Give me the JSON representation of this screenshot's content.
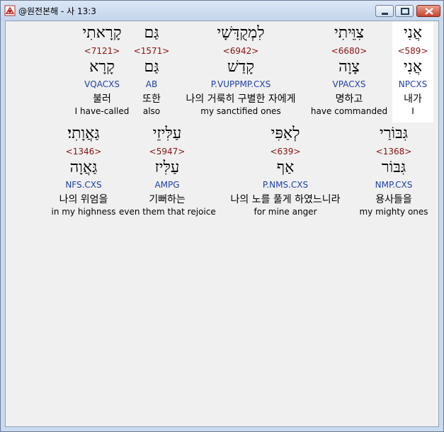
{
  "window": {
    "title": "@원전본해 - 사 13:3"
  },
  "row1": [
    {
      "word": "אֲנִי",
      "strong": "<589>",
      "lemma": "אֲנִי",
      "morph": "NPCXS",
      "korean": "내가",
      "english": "I",
      "highlight": true
    },
    {
      "word": "צִוֵּיתִי",
      "strong": "<6680>",
      "lemma": "צָוָה",
      "morph": "VPACXS",
      "korean": "명하고",
      "english": "have commanded",
      "highlight": false
    },
    {
      "word": "לִמְקֻדָּשָׁי",
      "strong": "<6942>",
      "lemma": "קָדַשׁ",
      "morph": "P.VUPPMP.CXS",
      "korean": "나의 거룩히 구별한 자에게",
      "english": "my sanctified ones",
      "highlight": false
    },
    {
      "word": "גַּם",
      "strong": "<1571>",
      "lemma": "גַּם",
      "morph": "AB",
      "korean": "또한",
      "english": "also",
      "highlight": false
    },
    {
      "word": "קָרָאתִי",
      "strong": "<7121>",
      "lemma": "קָרָא",
      "morph": "VQACXS",
      "korean": "불러",
      "english": "I have-called",
      "highlight": false
    }
  ],
  "row2": [
    {
      "word": "גִּבּוֹרַי",
      "strong": "<1368>",
      "lemma": "גִּבּוֹר",
      "morph": "NMP.CXS",
      "korean": "용사들을",
      "english": "my mighty ones"
    },
    {
      "word": "לְאַפִּי",
      "strong": "<639>",
      "lemma": "אַף",
      "morph": "P.NMS.CXS",
      "korean": "나의 노를 풀게 하였느니라",
      "english": "for mine anger"
    },
    {
      "word": "עַלִּיזֵי",
      "strong": "<5947>",
      "lemma": "עַלִּיז",
      "morph": "AMPG",
      "korean": "기뻐하는",
      "english": "even them that rejoice"
    },
    {
      "word": "גַּאֲוָתִי׃",
      "strong": "<1346>",
      "lemma": "גַּאֲוָה",
      "morph": "NFS.CXS",
      "korean": "나의 위엄을",
      "english": "in my highness"
    }
  ],
  "colors": {
    "strong": "#8b1010",
    "morph": "#1f3fa8"
  },
  "icons": [
    "app-icon",
    "minimize-icon",
    "maximize-icon",
    "close-icon"
  ]
}
